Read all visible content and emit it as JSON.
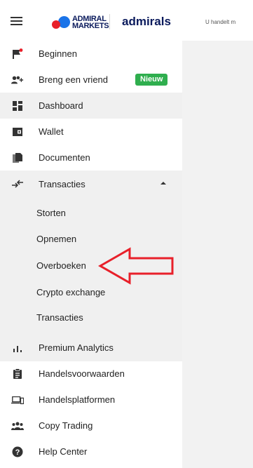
{
  "header": {
    "logo_line1": "ADMIRAL",
    "logo_line2": "MARKETS",
    "brand": "admirals",
    "tagline": "U handelt m"
  },
  "sidebar": {
    "items": [
      {
        "label": "Beginnen",
        "icon": "flag-icon"
      },
      {
        "label": "Breng een vriend",
        "icon": "add-friend-icon",
        "badge": "Nieuw"
      },
      {
        "label": "Dashboard",
        "icon": "dashboard-icon"
      },
      {
        "label": "Wallet",
        "icon": "wallet-icon"
      },
      {
        "label": "Documenten",
        "icon": "documents-icon"
      },
      {
        "label": "Transacties",
        "icon": "transfer-arrows-icon"
      }
    ],
    "transactions_submenu": [
      {
        "label": "Storten"
      },
      {
        "label": "Opnemen"
      },
      {
        "label": "Overboeken"
      },
      {
        "label": "Crypto exchange"
      },
      {
        "label": "Transacties"
      }
    ],
    "bottom_items": [
      {
        "label": "Premium Analytics",
        "icon": "analytics-icon"
      },
      {
        "label": "Handelsvoorwaarden",
        "icon": "clipboard-icon"
      },
      {
        "label": "Handelsplatformen",
        "icon": "platforms-icon"
      },
      {
        "label": "Copy Trading",
        "icon": "copy-trading-icon"
      },
      {
        "label": "Help Center",
        "icon": "help-icon"
      }
    ]
  },
  "colors": {
    "badge_green": "#2fae4e",
    "arrow_red": "#e8202a",
    "brand_navy": "#0a1a5c"
  }
}
